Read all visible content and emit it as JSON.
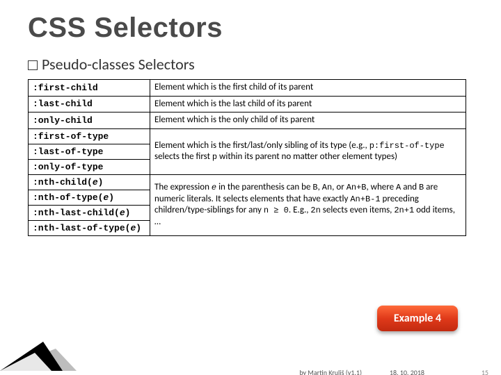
{
  "title": "CSS Selectors",
  "subtitle_main": "Pseudo-classes",
  "subtitle_tail": " Selectors",
  "rows": [
    {
      "sel": ":first-child",
      "desc_plain": "Element which is the first child of its parent"
    },
    {
      "sel": ":last-child",
      "desc_plain": "Element which is the last child of its parent"
    },
    {
      "sel": ":only-child",
      "desc_plain": "Element which is the only child of its parent"
    },
    {
      "sel": ":first-of-type",
      "group_start": true,
      "group_rows": 3
    },
    {
      "sel": ":last-of-type"
    },
    {
      "sel": ":only-of-type"
    },
    {
      "sel": ":nth-child(e)",
      "italic_at": 11,
      "group_start": true,
      "group_rows": 4
    },
    {
      "sel": ":nth-of-type(e)",
      "italic_at": 13
    },
    {
      "sel": ":nth-last-child(e)",
      "italic_at": 16
    },
    {
      "sel": ":nth-last-of-type(e)",
      "italic_at": 18
    }
  ],
  "desc_oftype": {
    "t1": "Element which is the first/last/only sibling of its type (e.g., ",
    "c1": "p:first-of-type",
    "t2": " selects the first ",
    "c2": "p",
    "t3": " within its parent no matter other element types)"
  },
  "desc_nth": {
    "t1": "The expression ",
    "c_e": "e",
    "t2": " in the parenthesis can be ",
    "c_B": "B",
    "t3": ", ",
    "c_An": "An",
    "t4": ", or ",
    "c_AnB": "An+B",
    "t5": ", where ",
    "c_A": "A",
    "t6": " and ",
    "c_B2": "B",
    "t7": " are numeric literals. It selects elements that have exactly ",
    "c_AnB1": "An+B-1",
    "t8": " preceding children/type-siblings for any ",
    "c_n": "n ≥ 0",
    "t9": ". E.g., ",
    "c_2n": "2n",
    "t10": " selects even items, ",
    "c_2n1": "2n+1",
    "t11": " odd items, …"
  },
  "example_label": "Example 4",
  "footer": {
    "author": "by Martin Kruliš (v1.1)",
    "date": "18. 10. 2018",
    "page": "15"
  }
}
